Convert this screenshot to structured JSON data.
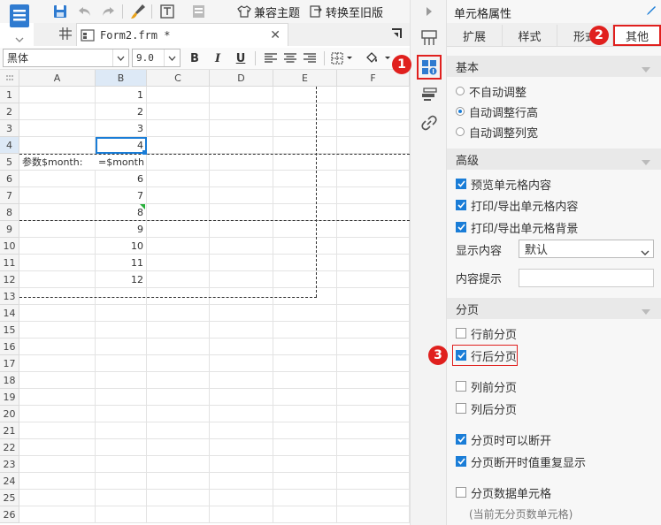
{
  "toolbar": {
    "theme_label": "兼容主题",
    "convert_label": "转换至旧版"
  },
  "file_tab": {
    "name": "Form2.frm *"
  },
  "format": {
    "font_family": "黑体",
    "font_size": "9.0",
    "bold": "B",
    "italic": "I",
    "underline": "U"
  },
  "grid": {
    "columns": [
      "A",
      "B",
      "C",
      "D",
      "E",
      "F"
    ],
    "rows": [
      "1",
      "2",
      "3",
      "4",
      "5",
      "6",
      "7",
      "8",
      "9",
      "10",
      "11",
      "12",
      "13",
      "14",
      "15",
      "16",
      "17",
      "18",
      "19",
      "20",
      "21",
      "22",
      "23",
      "24",
      "25",
      "26"
    ],
    "cells": {
      "b1": "1",
      "b2": "2",
      "b3": "3",
      "b4": "4",
      "a5": "参数$month:",
      "b5": "=$month",
      "b6": "6",
      "b7": "7",
      "b8": "8",
      "b9": "9",
      "b10": "10",
      "b11": "11",
      "b12": "12"
    },
    "selected_cell": "B4"
  },
  "panel": {
    "title": "单元格属性",
    "tabs": [
      "扩展",
      "样式",
      "形式",
      "其他"
    ],
    "active_tab": "其他",
    "basic": {
      "title": "基本",
      "options": [
        "不自动调整",
        "自动调整行高",
        "自动调整列宽"
      ],
      "selected": "自动调整行高"
    },
    "advanced": {
      "title": "高级",
      "checks": [
        {
          "label": "预览单元格内容",
          "checked": true
        },
        {
          "label": "打印/导出单元格内容",
          "checked": true
        },
        {
          "label": "打印/导出单元格背景",
          "checked": true
        }
      ],
      "display_label": "显示内容",
      "display_value": "默认",
      "tooltip_label": "内容提示",
      "tooltip_value": ""
    },
    "paging": {
      "title": "分页",
      "checks": [
        {
          "label": "行前分页",
          "checked": false
        },
        {
          "label": "行后分页",
          "checked": true
        },
        {
          "label": "列前分页",
          "checked": false
        },
        {
          "label": "列后分页",
          "checked": false
        },
        {
          "label": "分页时可以断开",
          "checked": true
        },
        {
          "label": "分页断开时值重复显示",
          "checked": true
        },
        {
          "label": "分页数据单元格",
          "checked": false
        }
      ],
      "note": "(当前无分页数单元格)"
    }
  },
  "callouts": [
    "1",
    "2",
    "3"
  ],
  "colors": {
    "accent": "#1a7dd7",
    "callout": "#e0201e"
  }
}
